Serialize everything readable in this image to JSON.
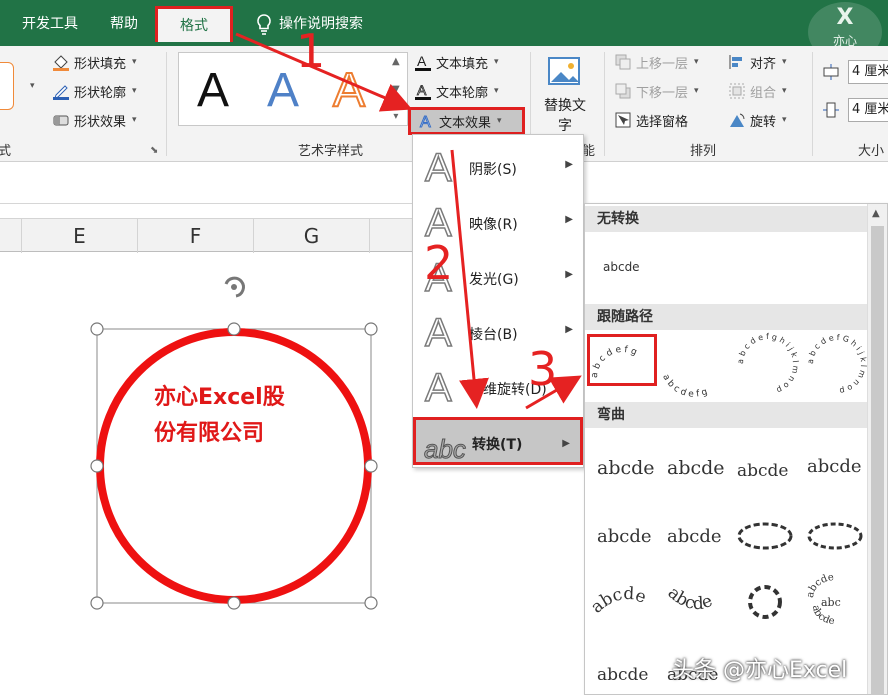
{
  "tabs": {
    "developer": "开发工具",
    "help": "帮助",
    "format": "格式",
    "tell_me": "操作说明搜索"
  },
  "logo": {
    "mark": "X",
    "text": "亦心"
  },
  "ribbon": {
    "shape_fill": "形状填充",
    "shape_outline": "形状轮廓",
    "shape_effect": "形状效果",
    "shape_styles_group": "式",
    "wordart_group": "艺术字样式",
    "wordart_sample": "A",
    "text_fill": "文本填充",
    "text_outline": "文本轮廓",
    "text_effect": "文本效果",
    "replace_text": "替换文字",
    "accessibility_group_tail": "能",
    "bring_forward": "上移一层",
    "send_backward": "下移一层",
    "selection_pane": "选择窗格",
    "align": "对齐",
    "group": "组合",
    "rotate": "旋转",
    "arrange_group": "排列",
    "height": "4 厘米",
    "width": "4 厘米",
    "size_group": "大小"
  },
  "columns": [
    "E",
    "F",
    "G"
  ],
  "shape": {
    "line1": "亦心Excel股",
    "line2": "份有限公司"
  },
  "effect_menu": {
    "items": [
      "阴影(S)",
      "映像(R)",
      "发光(G)",
      "棱台(B)",
      "三维旋转(D)",
      "转换(T)"
    ]
  },
  "transform": {
    "no_transform": "无转换",
    "no_transform_sample": "abcde",
    "follow_path": "跟随路径",
    "warp": "弯曲",
    "path_samples": [
      "a b c d e f g",
      "a b c d e f g",
      "a b c d e f g h i j k l m n o p",
      "a b c d e f G h i j k l m n o p"
    ],
    "warp_sample": "abcde",
    "warp_sample_2": "abc"
  },
  "annotations": {
    "one": "1",
    "two": "2",
    "three": "3"
  },
  "watermark": "头条 @亦心Excel",
  "colors": {
    "excel_green": "#217346",
    "annotation_red": "#e02020",
    "shape_red": "#ee1111"
  },
  "icons": [
    "lightbulb-icon",
    "paint-bucket-icon",
    "pen-icon",
    "eraser-icon",
    "text-a-icon",
    "image-icon",
    "layers-icon",
    "rotate-icon",
    "align-icon",
    "group-icon"
  ]
}
